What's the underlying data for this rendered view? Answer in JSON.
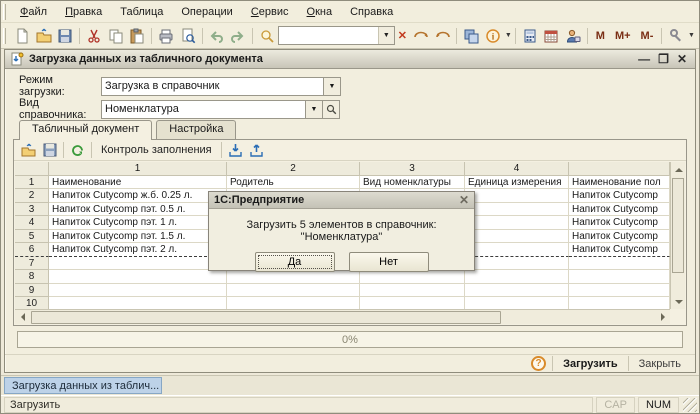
{
  "menu_bar": {
    "items": [
      {
        "label": "Файл"
      },
      {
        "label": "Правка"
      },
      {
        "label": "Таблица"
      },
      {
        "label": "Операции"
      },
      {
        "label": "Сервис"
      },
      {
        "label": "Окна"
      },
      {
        "label": "Справка"
      }
    ]
  },
  "toolbar": {
    "search_value": "",
    "memory_buttons": [
      "M",
      "M+",
      "M-"
    ]
  },
  "window": {
    "title": "Загрузка данных из табличного документа",
    "fields": {
      "mode_label": "Режим загрузки:",
      "mode_value": "Загрузка в справочник",
      "catalog_label": "Вид справочника:",
      "catalog_value": "Номенклатура"
    },
    "tabs": [
      {
        "label": "Табличный документ"
      },
      {
        "label": "Настройка"
      }
    ],
    "table_toolbar": {
      "fill_control_label": "Контроль заполнения"
    },
    "table": {
      "col_numbers": [
        "1",
        "2",
        "3",
        "4",
        ""
      ],
      "rows": [
        {
          "n": "1",
          "cells": [
            "Наименование",
            "Родитель",
            "Вид номенклатуры",
            "Единица измерения",
            "Наименование пол"
          ]
        },
        {
          "n": "2",
          "cells": [
            "Напиток Cutycomp ж.б. 0.25 л.",
            "",
            "",
            "",
            "Напиток Cutycomp"
          ]
        },
        {
          "n": "3",
          "cells": [
            "Напиток Cutycomp пэт. 0.5 л.",
            "",
            "",
            "",
            "Напиток Cutycomp"
          ]
        },
        {
          "n": "4",
          "cells": [
            "Напиток Cutycomp пэт. 1 л.",
            "",
            "",
            "",
            "Напиток Cutycomp"
          ]
        },
        {
          "n": "5",
          "cells": [
            "Напиток Cutycomp пэт. 1.5 л.",
            "",
            "",
            "",
            "Напиток Cutycomp"
          ]
        },
        {
          "n": "6",
          "cells": [
            "Напиток Cutycomp пэт. 2 л.",
            "",
            "",
            "",
            "Напиток Cutycomp"
          ]
        },
        {
          "n": "7",
          "cells": [
            "",
            "",
            "",
            "",
            ""
          ]
        },
        {
          "n": "8",
          "cells": [
            "",
            "",
            "",
            "",
            ""
          ]
        },
        {
          "n": "9",
          "cells": [
            "",
            "",
            "",
            "",
            ""
          ]
        },
        {
          "n": "10",
          "cells": [
            "",
            "",
            "",
            "",
            ""
          ]
        }
      ]
    },
    "progress": {
      "value": "0%"
    },
    "footer": {
      "load_label": "Загрузить",
      "close_label": "Закрыть"
    }
  },
  "dialog": {
    "title": "1С:Предприятие",
    "message": "Загрузить 5 элементов в справочник: \"Номенклатура\"",
    "yes_label": "Да",
    "no_label": "Нет"
  },
  "taskbar": {
    "items": [
      {
        "label": "Загрузка данных из таблич..."
      }
    ]
  },
  "statusbar": {
    "hint": "Загрузить",
    "cap_label": "CAP",
    "num_label": "NUM"
  },
  "colors": {
    "chrome_bg": "#f2eedd",
    "window_bg": "#f2eede",
    "panel_bg": "#f4f0e1",
    "selection_blue": "#bdd2e8",
    "accent_orange": "#d98b2b"
  }
}
